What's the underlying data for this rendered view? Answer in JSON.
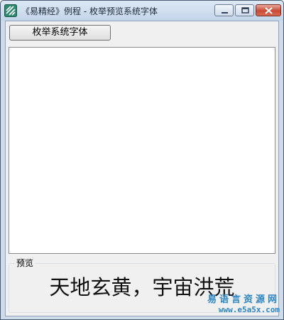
{
  "window": {
    "title": "《易精经》例程 - 枚举预览系统字体",
    "controls": [
      "minimize",
      "maximize",
      "close"
    ],
    "accent": "#d24e36"
  },
  "toolbar": {
    "enum_label": "枚举系统字体"
  },
  "font_list": {
    "items": []
  },
  "preview": {
    "group_label": "预览",
    "sample_text": "天地玄黄，宇宙洪荒"
  },
  "watermark": {
    "name": "易语言资源网",
    "url": "www.e5a5x.com",
    "color": "#2c86c4"
  },
  "icons": {
    "app": "stripes-app-icon",
    "minimize": "minimize-icon",
    "maximize": "maximize-icon",
    "close": "close-icon"
  }
}
